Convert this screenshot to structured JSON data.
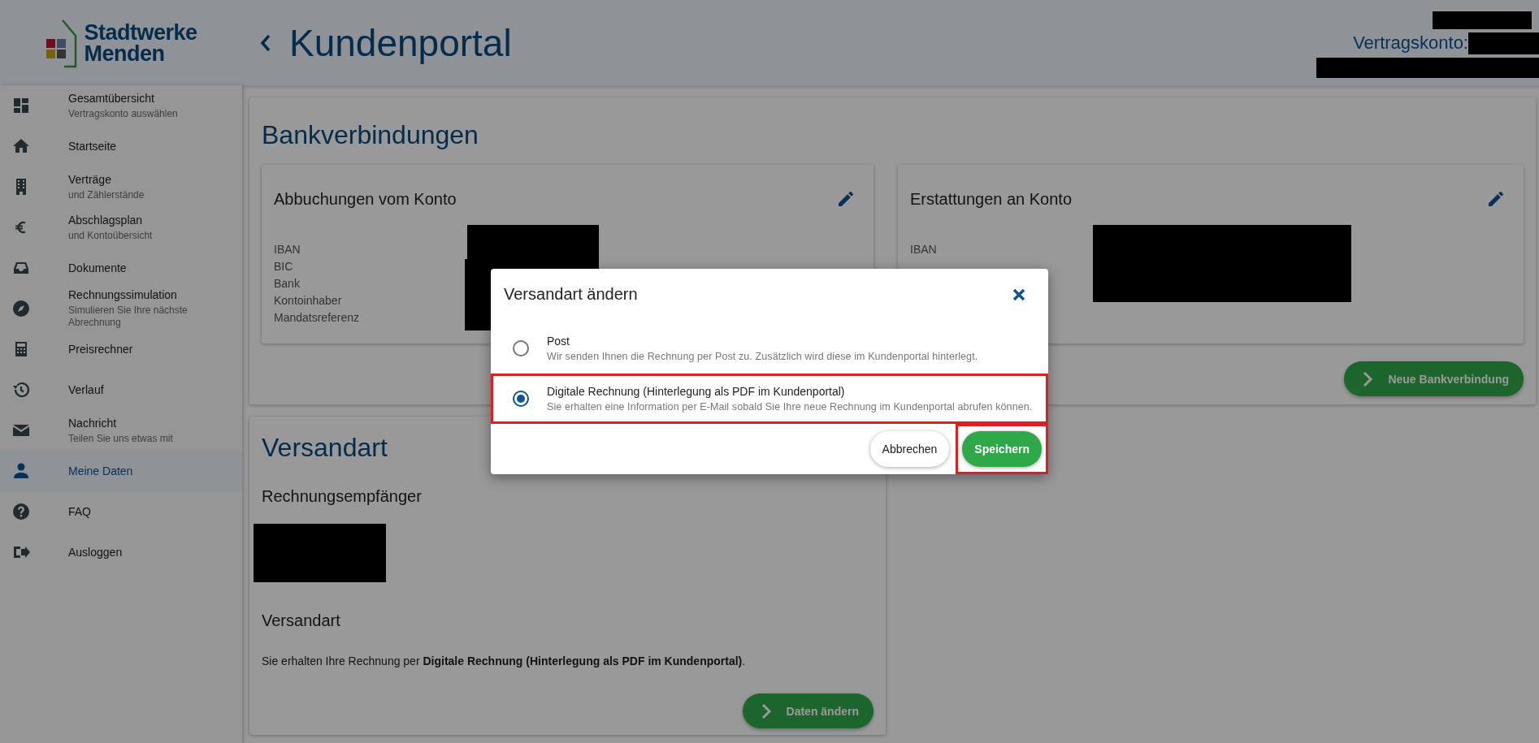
{
  "logo": {
    "line_1": "Stadtwerke",
    "line_2": "Menden"
  },
  "header": {
    "title": "Kundenportal",
    "account_label": "Vertragskonto:"
  },
  "sidebar": {
    "items": [
      {
        "label": "Gesamtübersicht",
        "sublabel": "Vertragskonto auswählen",
        "selected": false
      },
      {
        "label": "Startseite",
        "selected": false
      },
      {
        "label": "Verträge",
        "sublabel": "und Zählerstände",
        "selected": false
      },
      {
        "label": "Abschlagsplan",
        "sublabel": "und Kontoübersicht",
        "selected": false
      },
      {
        "label": "Dokumente",
        "selected": false
      },
      {
        "label": "Rechnungssimulation",
        "sublabel": "Simulieren Sie Ihre nächste Abrechnung",
        "selected": false
      },
      {
        "label": "Preisrechner",
        "selected": false
      },
      {
        "label": "Verlauf",
        "selected": false
      },
      {
        "label": "Nachricht",
        "sublabel": "Teilen Sie uns etwas mit",
        "selected": false
      },
      {
        "label": "Meine Daten",
        "selected": true
      },
      {
        "label": "FAQ",
        "selected": false
      },
      {
        "label": "Ausloggen",
        "selected": false
      }
    ]
  },
  "bank_section": {
    "title": "Bankverbindungen",
    "cards": [
      {
        "title": "Abbuchungen vom Konto",
        "fields": [
          "IBAN",
          "BIC",
          "Bank",
          "Kontoinhaber",
          "Mandatsreferenz"
        ]
      },
      {
        "title": "Erstattungen an Konto",
        "fields": [
          "IBAN"
        ]
      }
    ],
    "button": "Neue Bankverbindung"
  },
  "shipping_section": {
    "title": "Versandart",
    "recipient_heading": "Rechnungsempfänger",
    "method_heading": "Versandart",
    "sentence": "Sie erhalten Ihre Rechnung per **Digitale Rechnung (Hinterlegung als PDF im Kundenportal)**.",
    "button": "Daten ändern"
  },
  "dialog": {
    "title": "Versandart ändern",
    "options": [
      {
        "label": "Post",
        "description": "Wir senden Ihnen die Rechnung per Post zu. Zusätzlich wird diese im Kundenportal hinterlegt.",
        "selected": false,
        "highlighted": false
      },
      {
        "label": "Digitale Rechnung (Hinterlegung als PDF im Kundenportal)",
        "description": "Sie erhalten eine Information per E-Mail sobald Sie Ihre neue Rechnung im Kundenportal abrufen können.",
        "selected": true,
        "highlighted": true
      }
    ],
    "buttons": [
      {
        "label": "Abbrechen",
        "kind": "secondary",
        "highlighted": false
      },
      {
        "label": "Speichern",
        "kind": "primary",
        "highlighted": true
      }
    ]
  }
}
